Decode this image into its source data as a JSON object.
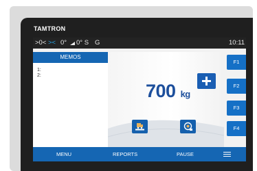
{
  "device": {
    "brand": "TAMTRON"
  },
  "status": {
    "zero_symbol": ">0<",
    "center_zero_symbol": "><",
    "tilt_indicator": "0°",
    "tilt_angle": "0° S",
    "gross_indicator": "G",
    "time": "10:11"
  },
  "memos": {
    "title": "MEMOS",
    "lines": [
      "1:",
      "2:"
    ]
  },
  "weight": {
    "value": "700",
    "unit": "kg"
  },
  "function_keys": [
    "F1",
    "F2",
    "F3",
    "F4"
  ],
  "bottom_nav": {
    "menu": "MENU",
    "reports": "REPORTS",
    "pause": "PAUSE"
  },
  "icons": {
    "add": "plus-icon",
    "vehicle_scale": "truck-scale-icon",
    "camera": "camera-icon",
    "menu": "hamburger-icon"
  },
  "colors": {
    "accent_blue": "#1566b3",
    "status_blue": "#27a4e6",
    "weight_text": "#1d4f9c"
  }
}
